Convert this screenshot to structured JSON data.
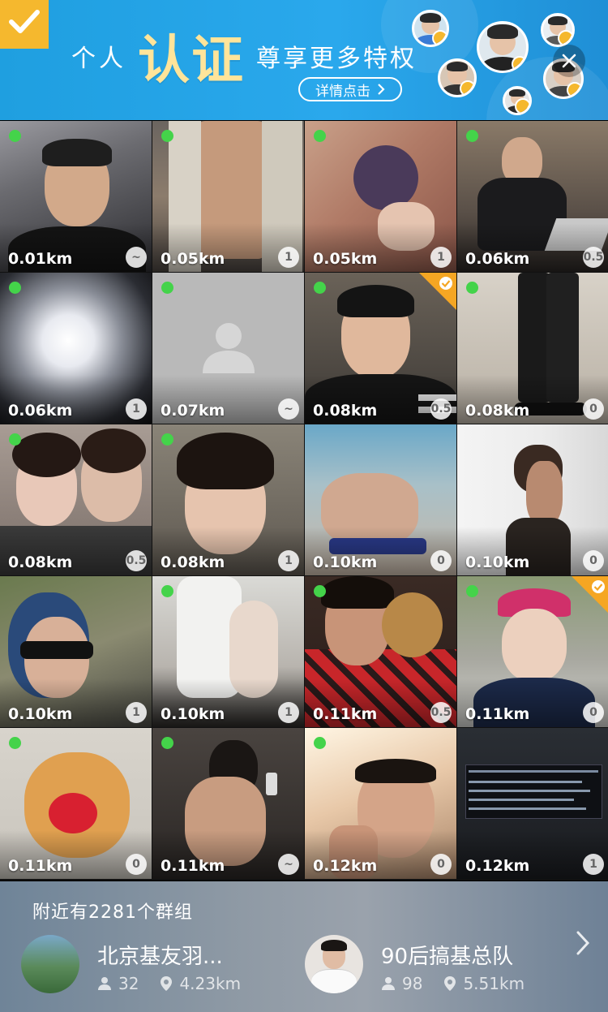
{
  "banner": {
    "title_prefix": "个人",
    "title_main": "认证",
    "title_suffix": "尊享更多特权",
    "detail_button": "详情点击",
    "colors": {
      "background": "#24a3e8",
      "accent": "#f5b82e",
      "title_main": "#ffe49a"
    }
  },
  "grid": {
    "tiles": [
      {
        "distance": "0.01km",
        "level": "~",
        "online": true,
        "verified": false
      },
      {
        "distance": "0.05km",
        "level": "1",
        "online": true,
        "verified": false
      },
      {
        "distance": "0.05km",
        "level": "1",
        "online": true,
        "verified": false
      },
      {
        "distance": "0.06km",
        "level": "0.5",
        "online": true,
        "verified": false
      },
      {
        "distance": "0.06km",
        "level": "1",
        "online": true,
        "verified": false
      },
      {
        "distance": "0.07km",
        "level": "~",
        "online": true,
        "verified": false
      },
      {
        "distance": "0.08km",
        "level": "0.5",
        "online": true,
        "verified": true
      },
      {
        "distance": "0.08km",
        "level": "0",
        "online": true,
        "verified": false
      },
      {
        "distance": "0.08km",
        "level": "0.5",
        "online": true,
        "verified": false
      },
      {
        "distance": "0.08km",
        "level": "1",
        "online": true,
        "verified": false
      },
      {
        "distance": "0.10km",
        "level": "0",
        "online": false,
        "verified": false
      },
      {
        "distance": "0.10km",
        "level": "0",
        "online": false,
        "verified": false
      },
      {
        "distance": "0.10km",
        "level": "1",
        "online": false,
        "verified": false
      },
      {
        "distance": "0.10km",
        "level": "1",
        "online": true,
        "verified": false
      },
      {
        "distance": "0.11km",
        "level": "0.5",
        "online": true,
        "verified": false
      },
      {
        "distance": "0.11km",
        "level": "0",
        "online": true,
        "verified": true
      },
      {
        "distance": "0.11km",
        "level": "0",
        "online": true,
        "verified": false
      },
      {
        "distance": "0.11km",
        "level": "~",
        "online": true,
        "verified": false
      },
      {
        "distance": "0.12km",
        "level": "0",
        "online": true,
        "verified": false
      },
      {
        "distance": "0.12km",
        "level": "1",
        "online": false,
        "verified": false
      }
    ]
  },
  "groups": {
    "heading": "附近有2281个群组",
    "items": [
      {
        "name": "北京基友羽...",
        "members": "32",
        "distance": "4.23km"
      },
      {
        "name": "90后搞基总队",
        "members": "98",
        "distance": "5.51km"
      }
    ]
  },
  "icons": {
    "verified": "checkmark-icon",
    "close": "close-icon",
    "online": "online-dot-icon",
    "member": "person-icon",
    "location": "location-pin-icon",
    "more": "chevron-right-icon"
  }
}
